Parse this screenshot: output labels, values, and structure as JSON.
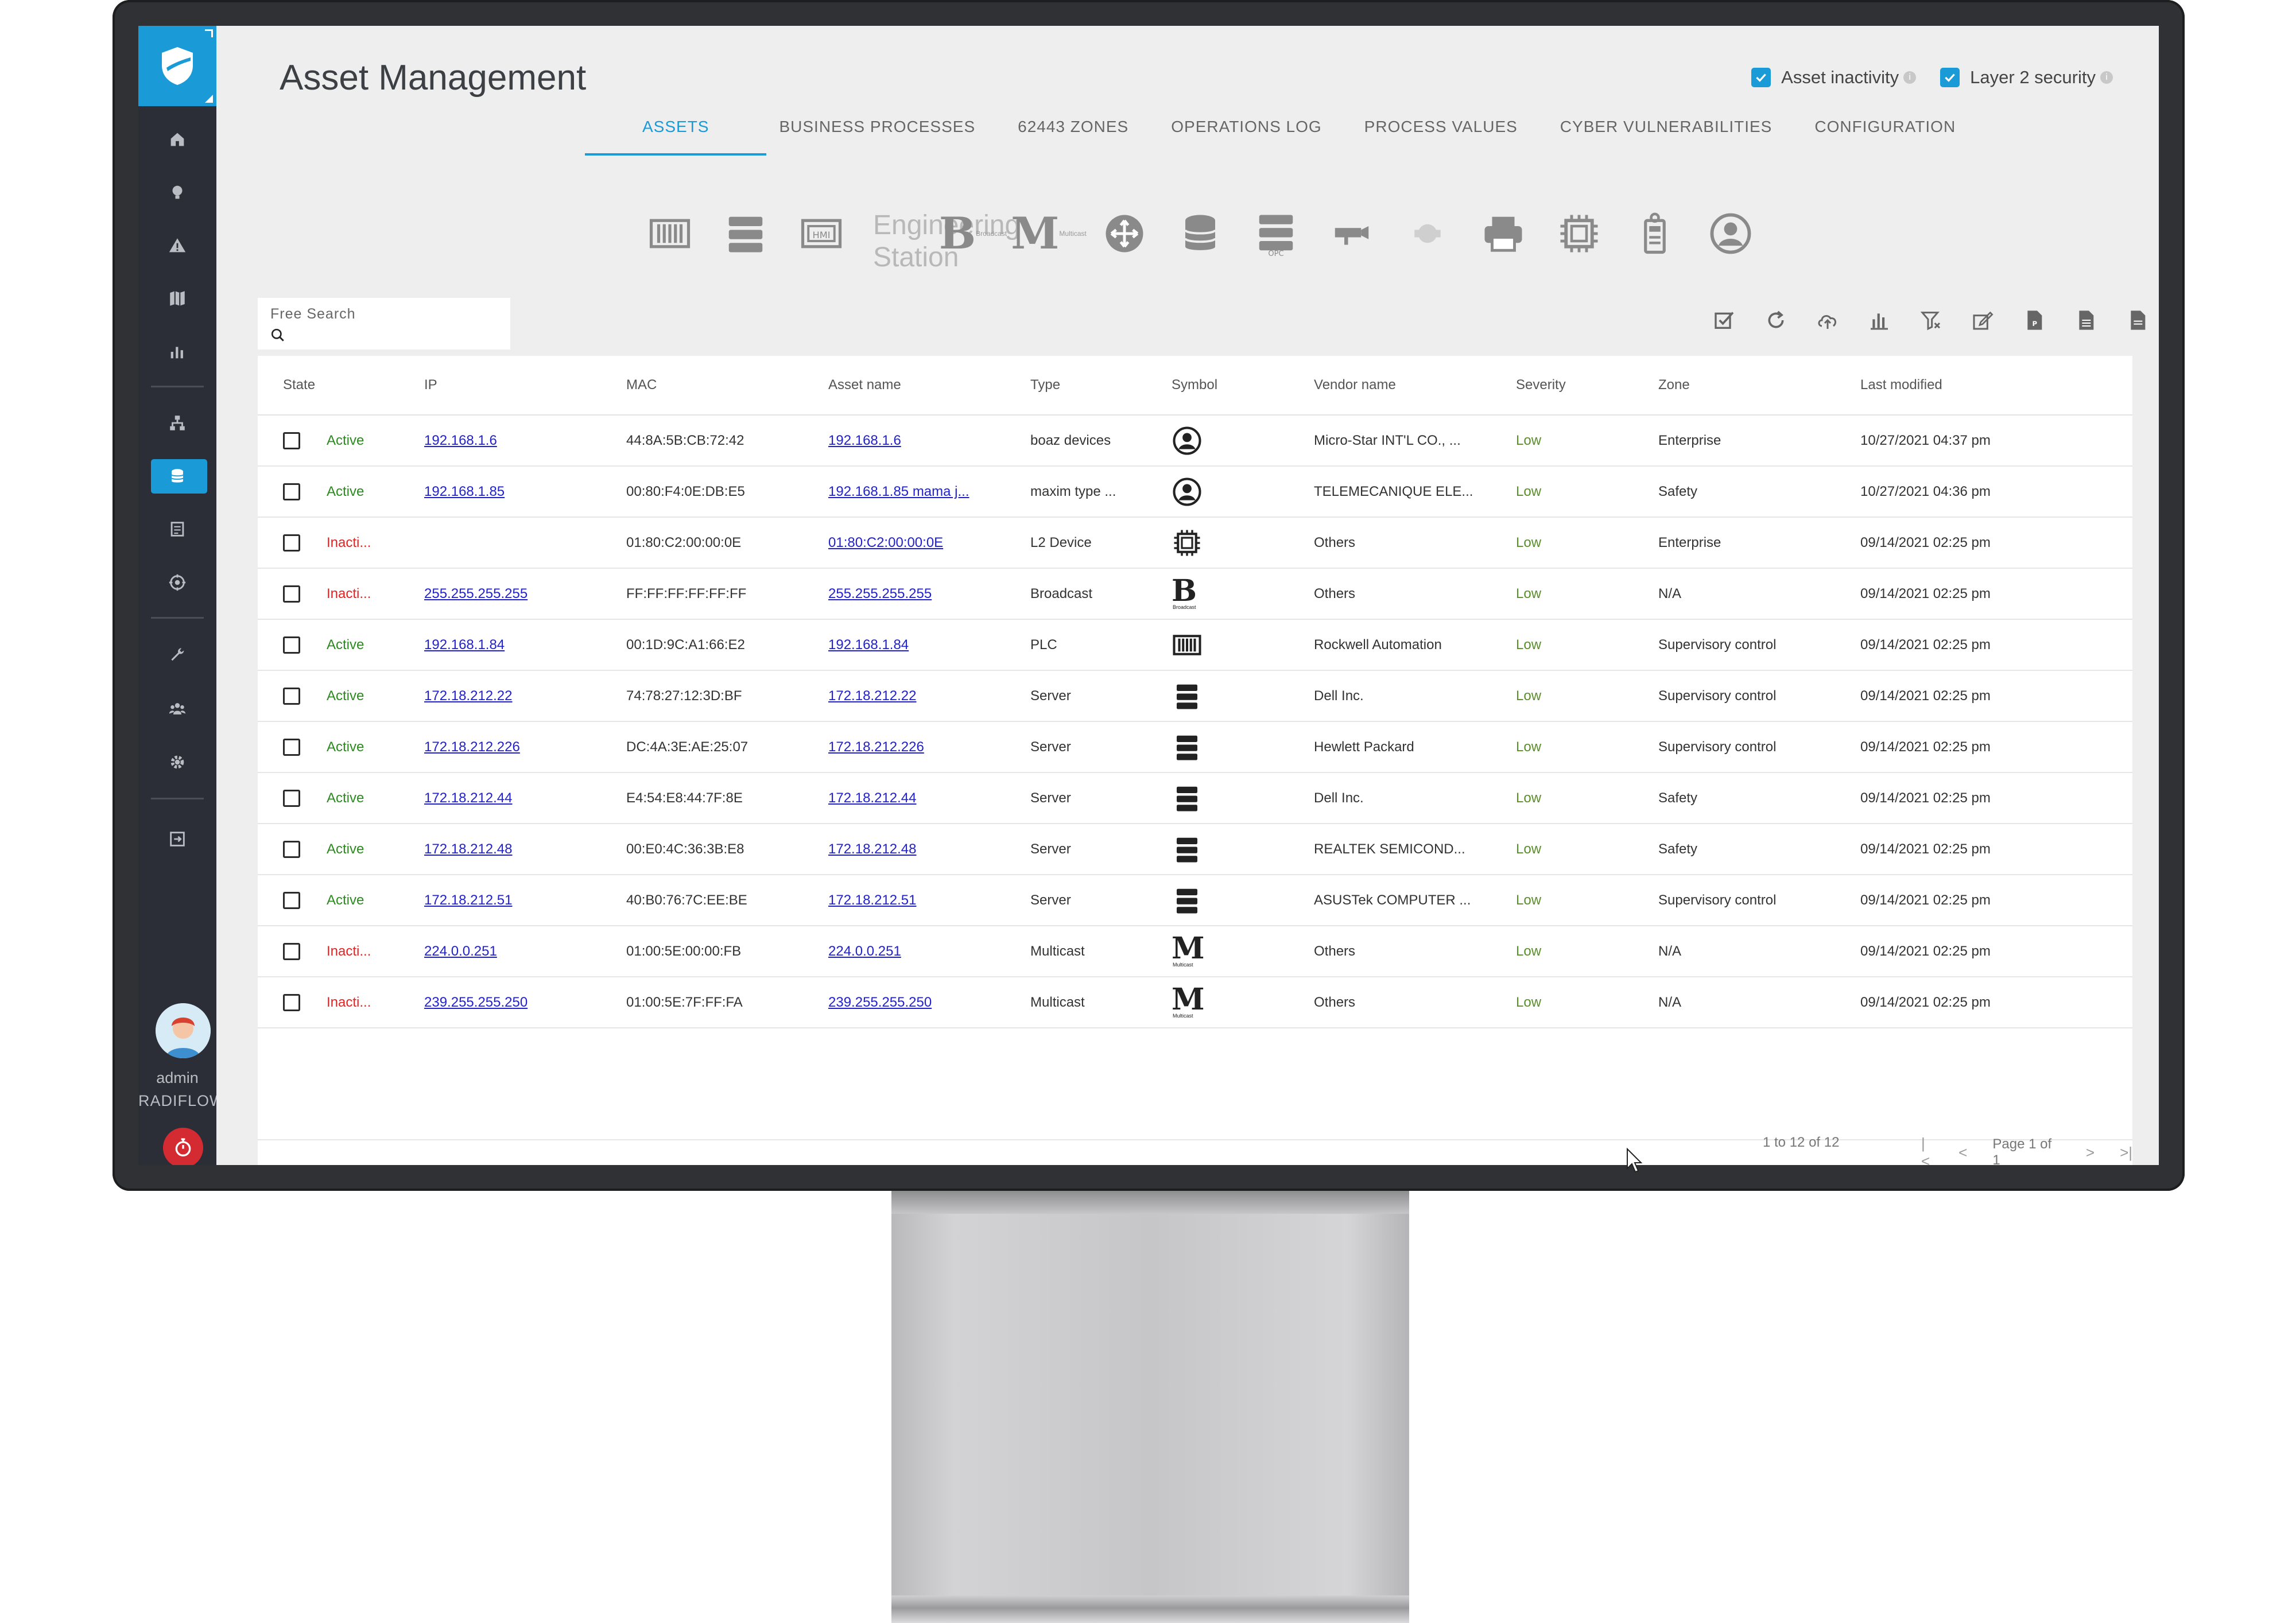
{
  "app": {
    "title": "Asset Management"
  },
  "header": {
    "toggles": [
      {
        "label": "Asset inactivity",
        "checked": true
      },
      {
        "label": "Layer 2 security",
        "checked": true
      }
    ]
  },
  "tabs": [
    {
      "label": "ASSETS",
      "active": true
    },
    {
      "label": "BUSINESS PROCESSES"
    },
    {
      "label": "62443 ZONES"
    },
    {
      "label": "OPERATIONS LOG"
    },
    {
      "label": "PROCESS VALUES"
    },
    {
      "label": "CYBER VULNERABILITIES"
    },
    {
      "label": "CONFIGURATION"
    }
  ],
  "type_strip": {
    "engineering_station": "Engineering Station",
    "broadcast_letter": "B",
    "broadcast_caption": "Broadcast",
    "multicast_letter": "M",
    "multicast_caption": "Multicast"
  },
  "search": {
    "label": "Free Search",
    "value": ""
  },
  "table": {
    "headers": [
      "State",
      "IP",
      "MAC",
      "Asset name",
      "Type",
      "Symbol",
      "Vendor name",
      "Severity",
      "Zone",
      "Last modified"
    ],
    "rows": [
      {
        "state": "Active",
        "ip": "192.168.1.6",
        "mac": "44:8A:5B:CB:72:42",
        "name": "192.168.1.6",
        "type": "boaz devices",
        "symbol": "user-icon",
        "vendor": "Micro-Star INT'L CO., ...",
        "severity": "Low",
        "zone": "Enterprise",
        "modified": "10/27/2021 04:37 pm"
      },
      {
        "state": "Active",
        "ip": "192.168.1.85",
        "mac": "00:80:F4:0E:DB:E5",
        "name": "192.168.1.85 mama j...",
        "type": "maxim type ...",
        "symbol": "user-icon",
        "vendor": "TELEMECANIQUE ELE...",
        "severity": "Low",
        "zone": "Safety",
        "modified": "10/27/2021 04:36 pm"
      },
      {
        "state": "Inacti...",
        "ip": "",
        "mac": "01:80:C2:00:00:0E",
        "name": "01:80:C2:00:00:0E",
        "type": "L2 Device",
        "symbol": "chip-icon",
        "vendor": "Others",
        "severity": "Low",
        "zone": "Enterprise",
        "modified": "09/14/2021 02:25 pm"
      },
      {
        "state": "Inacti...",
        "ip": "255.255.255.255",
        "mac": "FF:FF:FF:FF:FF:FF",
        "name": "255.255.255.255",
        "type": "Broadcast",
        "symbol": "broadcast-icon",
        "vendor": "Others",
        "severity": "Low",
        "zone": "N/A",
        "modified": "09/14/2021 02:25 pm"
      },
      {
        "state": "Active",
        "ip": "192.168.1.84",
        "mac": "00:1D:9C:A1:66:E2",
        "name": "192.168.1.84",
        "type": "PLC",
        "symbol": "plc-icon",
        "vendor": "Rockwell Automation",
        "severity": "Low",
        "zone": "Supervisory control",
        "modified": "09/14/2021 02:25 pm"
      },
      {
        "state": "Active",
        "ip": "172.18.212.22",
        "mac": "74:78:27:12:3D:BF",
        "name": "172.18.212.22",
        "type": "Server",
        "symbol": "server-icon",
        "vendor": "Dell Inc.",
        "severity": "Low",
        "zone": "Supervisory control",
        "modified": "09/14/2021 02:25 pm"
      },
      {
        "state": "Active",
        "ip": "172.18.212.226",
        "mac": "DC:4A:3E:AE:25:07",
        "name": "172.18.212.226",
        "type": "Server",
        "symbol": "server-icon",
        "vendor": "Hewlett Packard",
        "severity": "Low",
        "zone": "Supervisory control",
        "modified": "09/14/2021 02:25 pm"
      },
      {
        "state": "Active",
        "ip": "172.18.212.44",
        "mac": "E4:54:E8:44:7F:8E",
        "name": "172.18.212.44",
        "type": "Server",
        "symbol": "server-icon",
        "vendor": "Dell Inc.",
        "severity": "Low",
        "zone": "Safety",
        "modified": "09/14/2021 02:25 pm"
      },
      {
        "state": "Active",
        "ip": "172.18.212.48",
        "mac": "00:E0:4C:36:3B:E8",
        "name": "172.18.212.48",
        "type": "Server",
        "symbol": "server-icon",
        "vendor": "REALTEK SEMICOND...",
        "severity": "Low",
        "zone": "Safety",
        "modified": "09/14/2021 02:25 pm"
      },
      {
        "state": "Active",
        "ip": "172.18.212.51",
        "mac": "40:B0:76:7C:EE:BE",
        "name": "172.18.212.51",
        "type": "Server",
        "symbol": "server-icon",
        "vendor": "ASUSTek COMPUTER ...",
        "severity": "Low",
        "zone": "Supervisory control",
        "modified": "09/14/2021 02:25 pm"
      },
      {
        "state": "Inacti...",
        "ip": "224.0.0.251",
        "mac": "01:00:5E:00:00:FB",
        "name": "224.0.0.251",
        "type": "Multicast",
        "symbol": "multicast-icon",
        "vendor": "Others",
        "severity": "Low",
        "zone": "N/A",
        "modified": "09/14/2021 02:25 pm"
      },
      {
        "state": "Inacti...",
        "ip": "239.255.255.250",
        "mac": "01:00:5E:7F:FF:FA",
        "name": "239.255.255.250",
        "type": "Multicast",
        "symbol": "multicast-icon",
        "vendor": "Others",
        "severity": "Low",
        "zone": "N/A",
        "modified": "09/14/2021 02:25 pm"
      }
    ]
  },
  "pagination": {
    "count": "1 to 12 of 12",
    "page": "Page 1 of 1"
  },
  "user": {
    "name": "admin",
    "org": "RADIFLOW"
  },
  "colors": {
    "accent": "#1a9ad6",
    "sidebar": "#2b2e36",
    "active": "#2c8a20",
    "inactive": "#e02424",
    "link": "#2222cc",
    "alert": "#d42b33"
  }
}
